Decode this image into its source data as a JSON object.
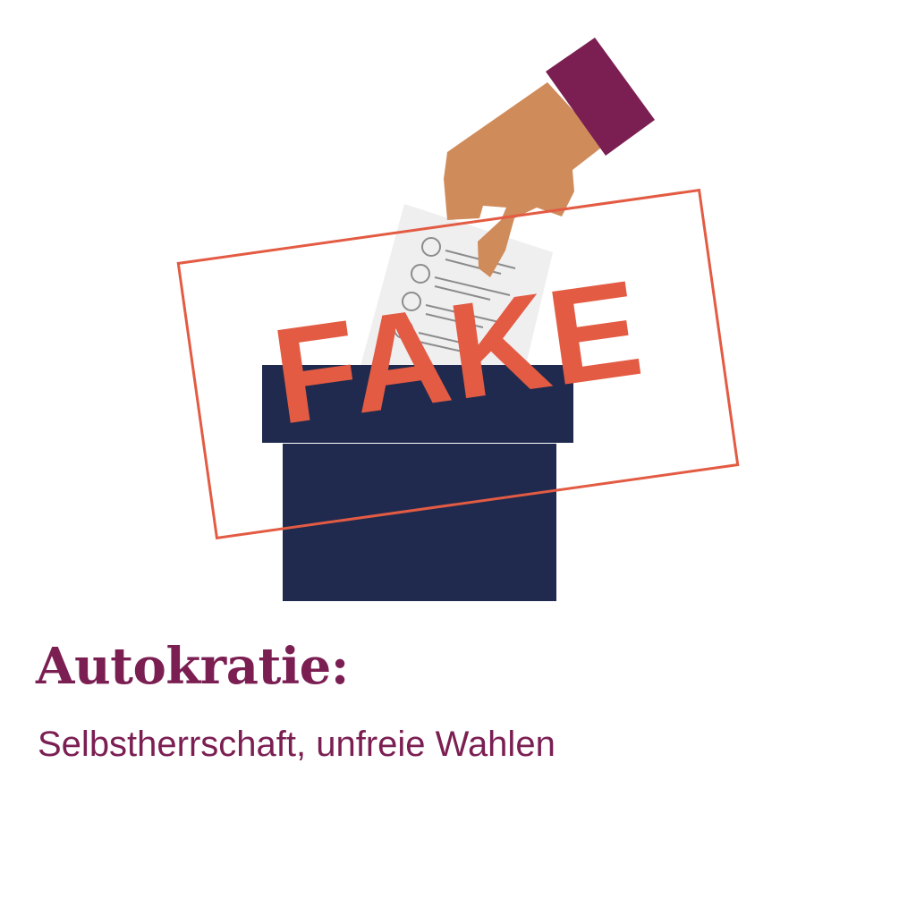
{
  "illustration": {
    "stamp_text": "FAKE"
  },
  "heading": {
    "title": "Autokratie:",
    "subtitle": "Selbstherrschaft, unfreie Wahlen"
  },
  "colors": {
    "background": "#ffffff",
    "ballot_box": "#1f2a4e",
    "stamp_red": "#e35b43",
    "sleeve_purple": "#7b1f53",
    "skin": "#d08b5b",
    "ballot_paper": "#efeff0",
    "text_purple": "#7b1f53"
  },
  "icons": {
    "ballot_box": "ballot-box-icon",
    "hand": "hand-icon",
    "ballot_paper": "ballot-paper-icon",
    "stamp": "fake-stamp-icon"
  }
}
